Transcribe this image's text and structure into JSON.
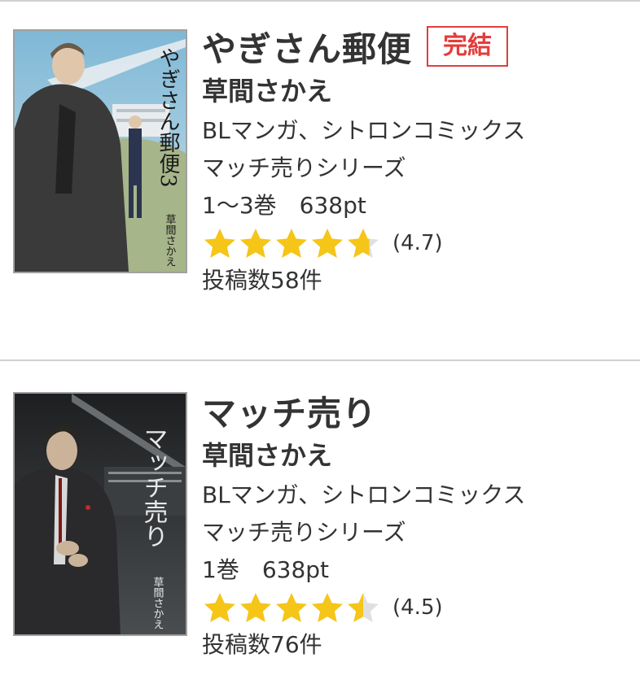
{
  "colors": {
    "badge_red": "#e33d3d",
    "star_gold": "#f5c518",
    "star_empty": "#e0e0e0",
    "divider": "#d0d0d0",
    "text": "#333333"
  },
  "items": [
    {
      "title": "やぎさん郵便",
      "badge": "完結",
      "author": "草間さかえ",
      "genre": "BLマンガ、シトロンコミックス",
      "series": "マッチ売りシリーズ",
      "volumes_price": "1〜3巻　638pt",
      "rating": 4.7,
      "rating_text": "(4.7)",
      "reviews": "投稿数58件",
      "cover": {
        "image_title": "やぎさん郵便3",
        "image_author": "草間さかえ",
        "icon": "manga-cover-image"
      }
    },
    {
      "title": "マッチ売り",
      "author": "草間さかえ",
      "genre": "BLマンガ、シトロンコミックス",
      "series": "マッチ売りシリーズ",
      "volumes_price": "1巻　638pt",
      "rating": 4.5,
      "rating_text": "(4.5)",
      "reviews": "投稿数76件",
      "cover": {
        "image_title": "マッチ売り",
        "image_author": "草間さかえ",
        "icon": "manga-cover-image"
      }
    }
  ]
}
